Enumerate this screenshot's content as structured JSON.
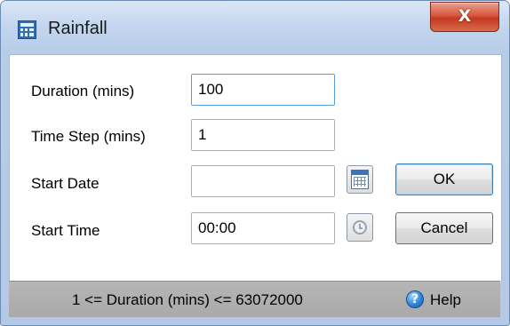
{
  "window": {
    "title": "Rainfall",
    "close_glyph": "X",
    "icon": "calculator-grid-icon"
  },
  "form": {
    "duration": {
      "label": "Duration (mins)",
      "value": "100"
    },
    "time_step": {
      "label": "Time Step (mins)",
      "value": "1"
    },
    "start_date": {
      "label": "Start Date",
      "value": "",
      "picker_icon": "calendar-icon"
    },
    "start_time": {
      "label": "Start Time",
      "value": "00:00",
      "picker_icon": "clock-icon"
    }
  },
  "buttons": {
    "ok": "OK",
    "cancel": "Cancel"
  },
  "status": {
    "message": "1 <= Duration (mins) <= 63072000",
    "help_label": "Help",
    "help_glyph": "?",
    "help_icon": "help-icon"
  },
  "colors": {
    "title_bar": "#c4d6ee",
    "close_button": "#c23a21",
    "focus_border": "#569de5",
    "status_bar": "#a9a9a9"
  }
}
